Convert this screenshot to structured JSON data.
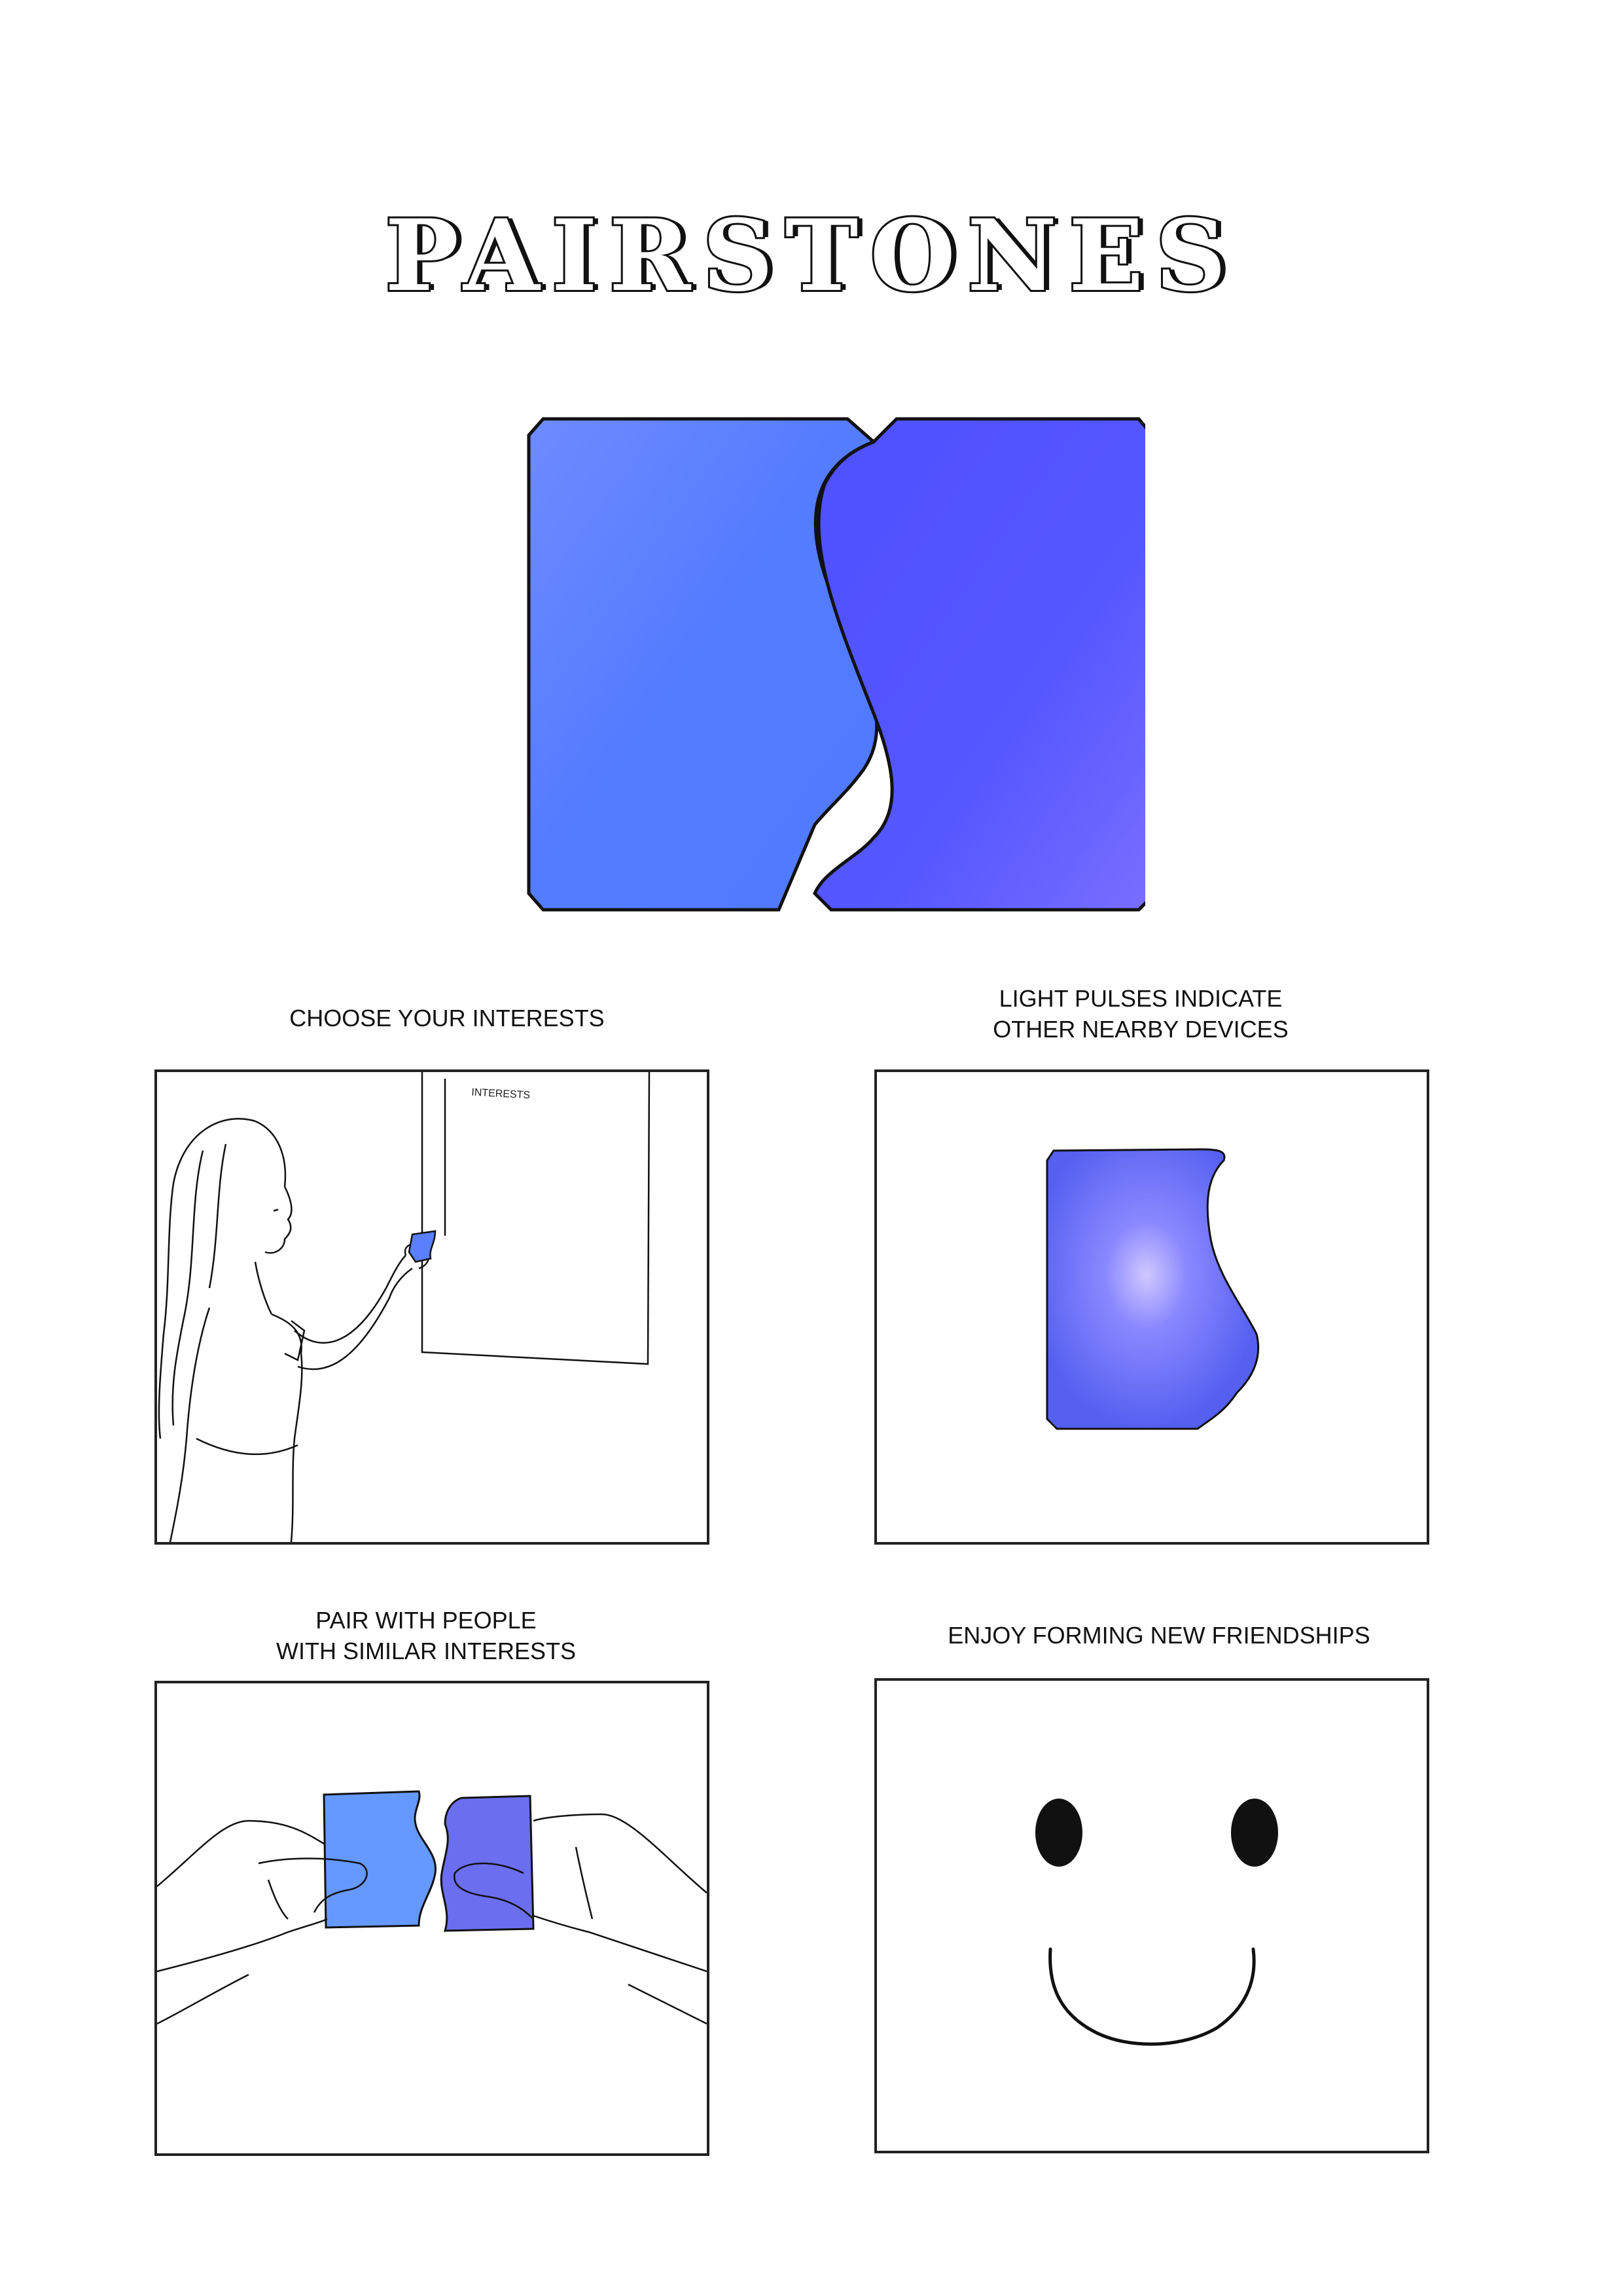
{
  "title": "PAIRSTONES",
  "panels": [
    {
      "caption": "CHOOSE YOUR INTERESTS",
      "board_label": "INTERESTS"
    },
    {
      "caption": "LIGHT PULSES INDICATE\nOTHER NEARBY DEVICES"
    },
    {
      "caption": "PAIR WITH PEOPLE\nWITH SIMILAR INTERESTS"
    },
    {
      "caption": "ENJOY FORMING NEW FRIENDSHIPS"
    }
  ],
  "colors": {
    "stone_light": "#5a7fff",
    "stone_dark": "#4f50ff",
    "outline": "#111111"
  }
}
